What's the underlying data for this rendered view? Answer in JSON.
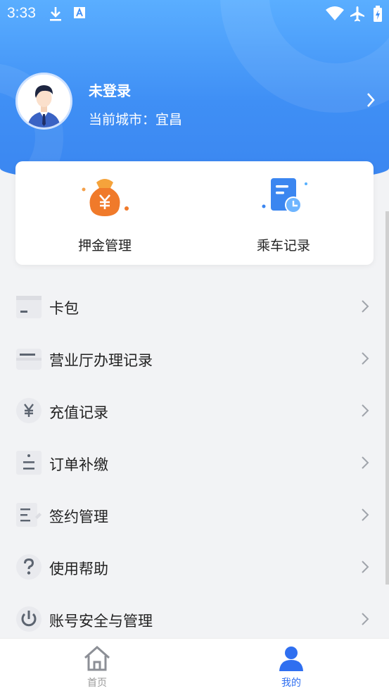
{
  "status_bar": {
    "time": "3:33",
    "icons": [
      "download-icon",
      "font-a-icon",
      "wifi-icon",
      "airplane-icon",
      "battery-icon"
    ]
  },
  "profile": {
    "login_status": "未登录",
    "city": "当前城市：宜昌"
  },
  "quick_actions": [
    {
      "label": "押金管理",
      "icon": "money-bag-icon"
    },
    {
      "label": "乘车记录",
      "icon": "ride-record-icon"
    }
  ],
  "menu": [
    {
      "label": "卡包",
      "icon": "card-wallet-icon"
    },
    {
      "label": "营业厅办理记录",
      "icon": "service-hall-icon"
    },
    {
      "label": "充值记录",
      "icon": "yen-icon"
    },
    {
      "label": "订单补缴",
      "icon": "order-icon"
    },
    {
      "label": "签约管理",
      "icon": "contract-icon"
    },
    {
      "label": "使用帮助",
      "icon": "help-icon"
    },
    {
      "label": "账号安全与管理",
      "icon": "power-icon"
    }
  ],
  "bottom_nav": [
    {
      "label": "首页",
      "icon": "home-icon",
      "active": false
    },
    {
      "label": "我的",
      "icon": "user-icon",
      "active": true
    }
  ],
  "colors": {
    "header_blue": "#3f8ff5",
    "active_nav": "#2f6ff0",
    "inactive_nav": "#9a9a9a",
    "orange": "#f07a2a"
  }
}
